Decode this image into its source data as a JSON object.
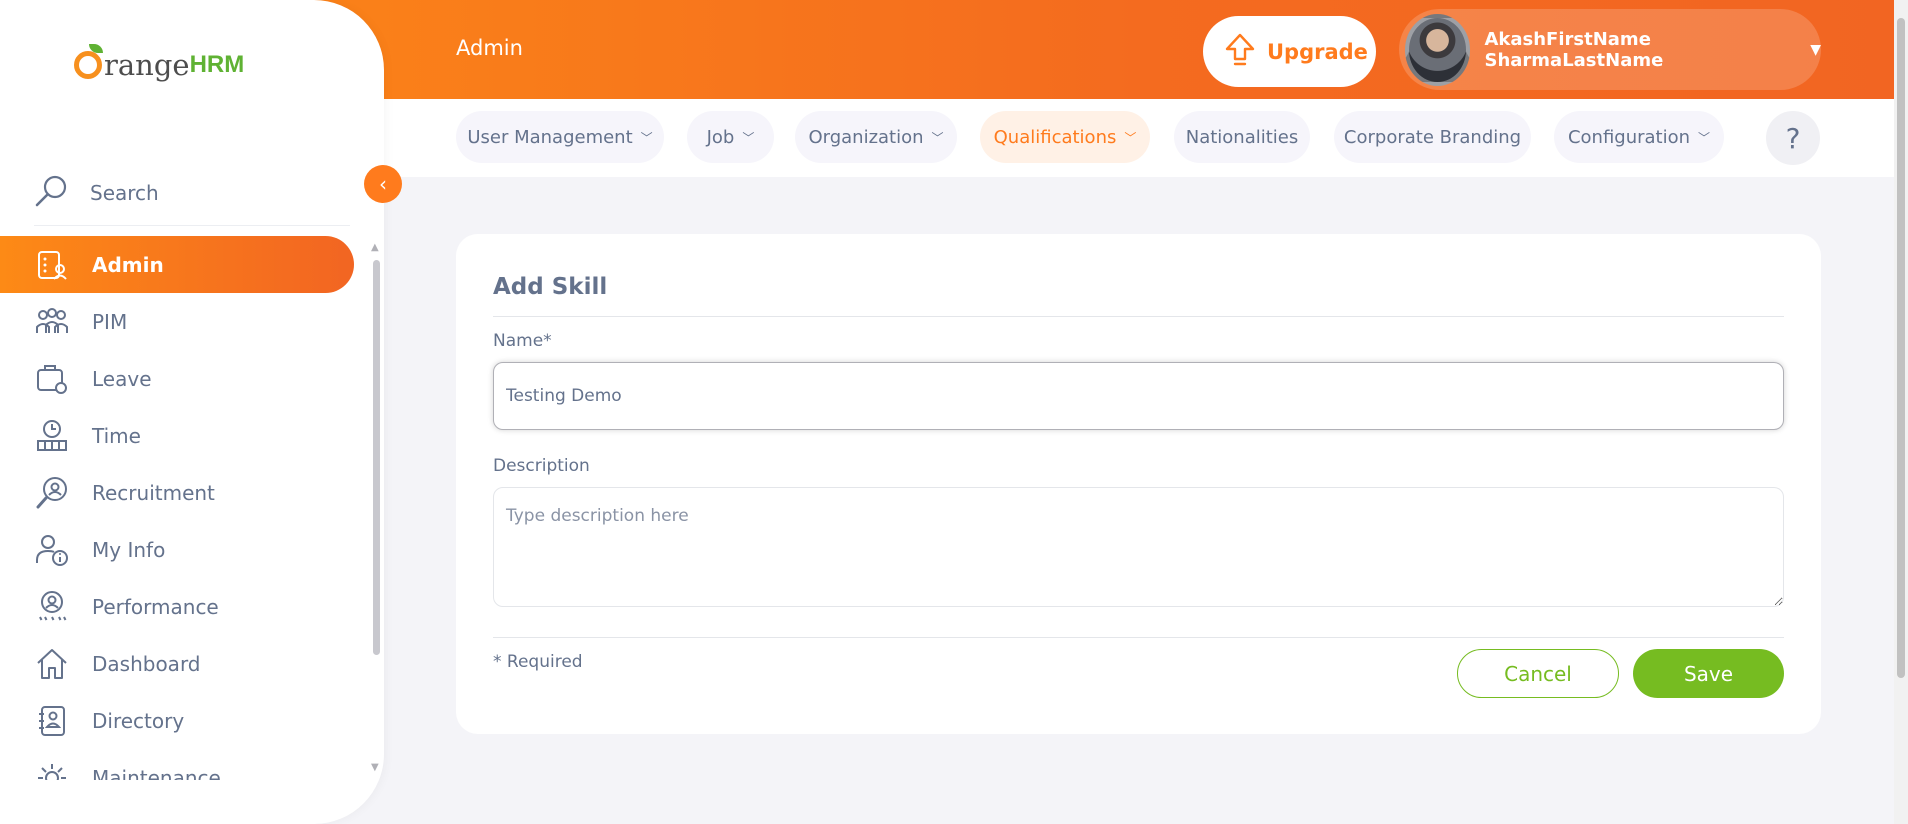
{
  "header": {
    "title": "Admin",
    "upgrade_label": "Upgrade",
    "user_name": "AkashFirstName SharmaLastName"
  },
  "tabs": [
    {
      "label": "User Management",
      "has_dropdown": true
    },
    {
      "label": "Job",
      "has_dropdown": true
    },
    {
      "label": "Organization",
      "has_dropdown": true
    },
    {
      "label": "Qualifications",
      "has_dropdown": true,
      "active": true
    },
    {
      "label": "Nationalities",
      "has_dropdown": false
    },
    {
      "label": "Corporate Branding",
      "has_dropdown": false
    },
    {
      "label": "Configuration",
      "has_dropdown": true
    }
  ],
  "help_label": "?",
  "sidebar": {
    "logo_text": "range",
    "logo_hrm": "HRM",
    "search_label": "Search",
    "items": [
      {
        "label": "Admin",
        "icon": "admin-icon",
        "active": true
      },
      {
        "label": "PIM",
        "icon": "pim-icon"
      },
      {
        "label": "Leave",
        "icon": "leave-icon"
      },
      {
        "label": "Time",
        "icon": "time-icon"
      },
      {
        "label": "Recruitment",
        "icon": "recruitment-icon"
      },
      {
        "label": "My Info",
        "icon": "my-info-icon"
      },
      {
        "label": "Performance",
        "icon": "performance-icon"
      },
      {
        "label": "Dashboard",
        "icon": "dashboard-icon"
      },
      {
        "label": "Directory",
        "icon": "directory-icon"
      },
      {
        "label": "Maintenance",
        "icon": "maintenance-icon"
      }
    ]
  },
  "form": {
    "title": "Add Skill",
    "name_label": "Name*",
    "name_value": "Testing Demo",
    "description_label": "Description",
    "description_placeholder": "Type description here",
    "required_note": "* Required",
    "cancel_label": "Cancel",
    "save_label": "Save"
  },
  "colors": {
    "accent": "#ff7b1d",
    "success": "#76bc21",
    "text": "#64728c"
  }
}
